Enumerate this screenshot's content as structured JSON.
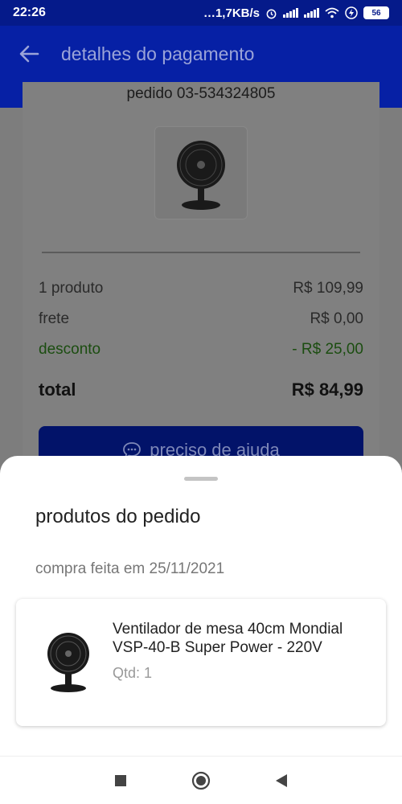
{
  "status_bar": {
    "time": "22:26",
    "network_speed": "…1,7KB/s",
    "battery": "56",
    "icons": [
      "alarm-icon",
      "signal-icon",
      "wifi-icon",
      "charging-icon",
      "battery-icon"
    ]
  },
  "header": {
    "title": "detalhes do pagamento",
    "back_icon": "arrow-left-icon"
  },
  "order": {
    "id_label": "pedido 03-534324805",
    "summary": {
      "products_label": "1 produto",
      "products_value": "R$ 109,99",
      "shipping_label": "frete",
      "shipping_value": "R$ 0,00",
      "discount_label": "desconto",
      "discount_value": "- R$ 25,00",
      "total_label": "total",
      "total_value": "R$ 84,99"
    },
    "help_button": "preciso de ajuda"
  },
  "sheet": {
    "title": "produtos do pedido",
    "purchase_date": "compra feita em 25/11/2021",
    "products": [
      {
        "name": "Ventilador de mesa 40cm Mondial VSP-40-B Super Power - 220V",
        "quantity": "Qtd: 1"
      }
    ]
  },
  "nav": {
    "recents_icon": "square-icon",
    "home_icon": "circle-icon",
    "back_icon": "triangle-back-icon"
  },
  "colors": {
    "primary": "#0620a5",
    "discount_green": "#1b4d10",
    "scrim": "#7d7d7d"
  }
}
